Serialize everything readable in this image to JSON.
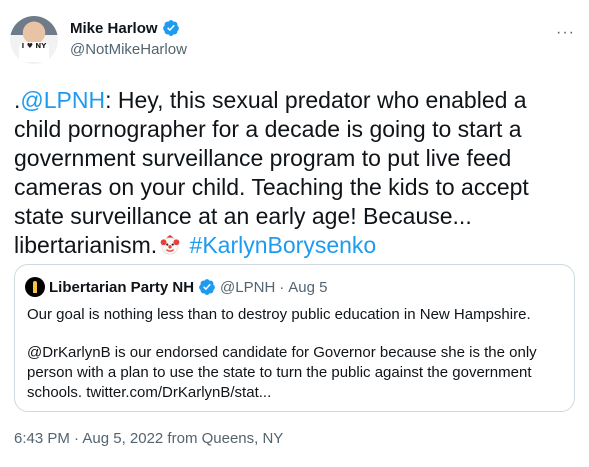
{
  "author": {
    "display_name": "Mike Harlow",
    "handle": "@NotMikeHarlow",
    "avatar_shirt_text": "I ♥ NY"
  },
  "tweet": {
    "text_prefix": ".",
    "mention": "@LPNH",
    "text_main": ": Hey, this sexual predator who enabled a child pornographer for a decade is going to start a government surveillance program to put live feed cameras on your child. Teaching the kids to accept state surveillance at an early age! Because... libertarianism.",
    "hashtag": "#KarlynBorysenko"
  },
  "quoted_tweet": {
    "display_name": "Libertarian Party NH",
    "handle": "@LPNH",
    "separator": "·",
    "date": "Aug 5",
    "paragraph_1": "Our goal is nothing less than to destroy public education in New Hampshire.",
    "paragraph_2": "@DrKarlynB is our endorsed candidate for Governor because she is the only person with a plan to use the state to turn the public against the government schools. twitter.com/DrKarlynB/stat..."
  },
  "timestamp": "6:43 PM · Aug 5, 2022 from Queens, NY",
  "icons": {
    "verified": "verified-badge-icon",
    "more": "more-options-icon",
    "clown": "clown-face-emoji"
  },
  "colors": {
    "link": "#1d9bf0",
    "secondary_text": "#536471",
    "border": "#cfd9de"
  }
}
